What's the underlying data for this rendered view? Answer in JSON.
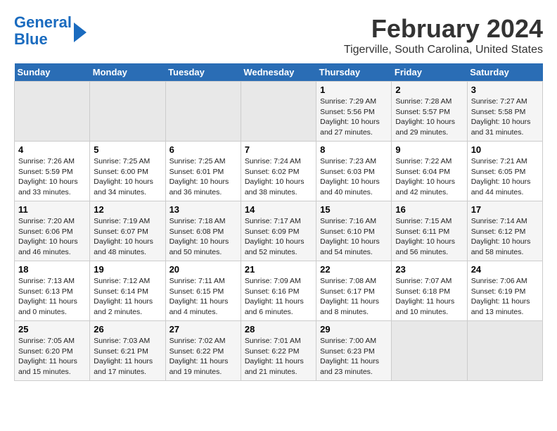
{
  "logo": {
    "line1": "General",
    "line2": "Blue"
  },
  "title": "February 2024",
  "location": "Tigerville, South Carolina, United States",
  "days_of_week": [
    "Sunday",
    "Monday",
    "Tuesday",
    "Wednesday",
    "Thursday",
    "Friday",
    "Saturday"
  ],
  "weeks": [
    [
      {
        "day": "",
        "content": ""
      },
      {
        "day": "",
        "content": ""
      },
      {
        "day": "",
        "content": ""
      },
      {
        "day": "",
        "content": ""
      },
      {
        "day": "1",
        "content": "Sunrise: 7:29 AM\nSunset: 5:56 PM\nDaylight: 10 hours and 27 minutes."
      },
      {
        "day": "2",
        "content": "Sunrise: 7:28 AM\nSunset: 5:57 PM\nDaylight: 10 hours and 29 minutes."
      },
      {
        "day": "3",
        "content": "Sunrise: 7:27 AM\nSunset: 5:58 PM\nDaylight: 10 hours and 31 minutes."
      }
    ],
    [
      {
        "day": "4",
        "content": "Sunrise: 7:26 AM\nSunset: 5:59 PM\nDaylight: 10 hours and 33 minutes."
      },
      {
        "day": "5",
        "content": "Sunrise: 7:25 AM\nSunset: 6:00 PM\nDaylight: 10 hours and 34 minutes."
      },
      {
        "day": "6",
        "content": "Sunrise: 7:25 AM\nSunset: 6:01 PM\nDaylight: 10 hours and 36 minutes."
      },
      {
        "day": "7",
        "content": "Sunrise: 7:24 AM\nSunset: 6:02 PM\nDaylight: 10 hours and 38 minutes."
      },
      {
        "day": "8",
        "content": "Sunrise: 7:23 AM\nSunset: 6:03 PM\nDaylight: 10 hours and 40 minutes."
      },
      {
        "day": "9",
        "content": "Sunrise: 7:22 AM\nSunset: 6:04 PM\nDaylight: 10 hours and 42 minutes."
      },
      {
        "day": "10",
        "content": "Sunrise: 7:21 AM\nSunset: 6:05 PM\nDaylight: 10 hours and 44 minutes."
      }
    ],
    [
      {
        "day": "11",
        "content": "Sunrise: 7:20 AM\nSunset: 6:06 PM\nDaylight: 10 hours and 46 minutes."
      },
      {
        "day": "12",
        "content": "Sunrise: 7:19 AM\nSunset: 6:07 PM\nDaylight: 10 hours and 48 minutes."
      },
      {
        "day": "13",
        "content": "Sunrise: 7:18 AM\nSunset: 6:08 PM\nDaylight: 10 hours and 50 minutes."
      },
      {
        "day": "14",
        "content": "Sunrise: 7:17 AM\nSunset: 6:09 PM\nDaylight: 10 hours and 52 minutes."
      },
      {
        "day": "15",
        "content": "Sunrise: 7:16 AM\nSunset: 6:10 PM\nDaylight: 10 hours and 54 minutes."
      },
      {
        "day": "16",
        "content": "Sunrise: 7:15 AM\nSunset: 6:11 PM\nDaylight: 10 hours and 56 minutes."
      },
      {
        "day": "17",
        "content": "Sunrise: 7:14 AM\nSunset: 6:12 PM\nDaylight: 10 hours and 58 minutes."
      }
    ],
    [
      {
        "day": "18",
        "content": "Sunrise: 7:13 AM\nSunset: 6:13 PM\nDaylight: 11 hours and 0 minutes."
      },
      {
        "day": "19",
        "content": "Sunrise: 7:12 AM\nSunset: 6:14 PM\nDaylight: 11 hours and 2 minutes."
      },
      {
        "day": "20",
        "content": "Sunrise: 7:11 AM\nSunset: 6:15 PM\nDaylight: 11 hours and 4 minutes."
      },
      {
        "day": "21",
        "content": "Sunrise: 7:09 AM\nSunset: 6:16 PM\nDaylight: 11 hours and 6 minutes."
      },
      {
        "day": "22",
        "content": "Sunrise: 7:08 AM\nSunset: 6:17 PM\nDaylight: 11 hours and 8 minutes."
      },
      {
        "day": "23",
        "content": "Sunrise: 7:07 AM\nSunset: 6:18 PM\nDaylight: 11 hours and 10 minutes."
      },
      {
        "day": "24",
        "content": "Sunrise: 7:06 AM\nSunset: 6:19 PM\nDaylight: 11 hours and 13 minutes."
      }
    ],
    [
      {
        "day": "25",
        "content": "Sunrise: 7:05 AM\nSunset: 6:20 PM\nDaylight: 11 hours and 15 minutes."
      },
      {
        "day": "26",
        "content": "Sunrise: 7:03 AM\nSunset: 6:21 PM\nDaylight: 11 hours and 17 minutes."
      },
      {
        "day": "27",
        "content": "Sunrise: 7:02 AM\nSunset: 6:22 PM\nDaylight: 11 hours and 19 minutes."
      },
      {
        "day": "28",
        "content": "Sunrise: 7:01 AM\nSunset: 6:22 PM\nDaylight: 11 hours and 21 minutes."
      },
      {
        "day": "29",
        "content": "Sunrise: 7:00 AM\nSunset: 6:23 PM\nDaylight: 11 hours and 23 minutes."
      },
      {
        "day": "",
        "content": ""
      },
      {
        "day": "",
        "content": ""
      }
    ]
  ]
}
